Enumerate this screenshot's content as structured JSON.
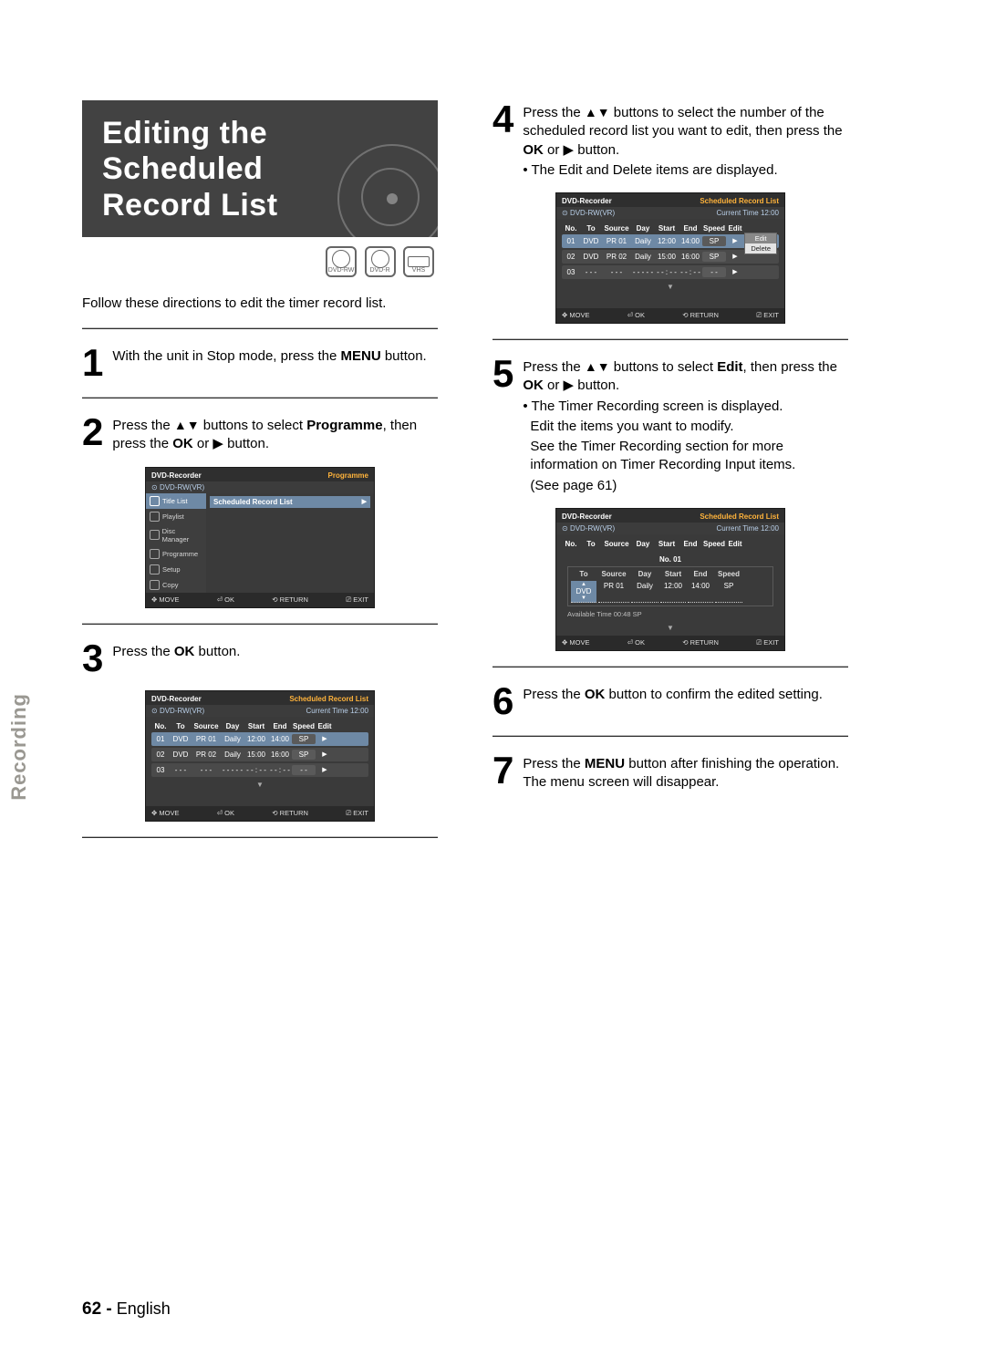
{
  "section_tab": "Recording",
  "title_line1": "Editing the Scheduled",
  "title_line2": "Record List",
  "media": {
    "a": "DVD-RW",
    "b": "DVD-R",
    "c": "VHS"
  },
  "intro": "Follow these directions to edit the timer record list.",
  "steps": {
    "1": {
      "num": "1",
      "a": "With the unit in Stop mode, press the ",
      "b": "MENU",
      "c": " button."
    },
    "2": {
      "num": "2",
      "a": "Press the ",
      "arrows": "▲▼",
      "b": " buttons to select ",
      "c": "Programme",
      "d": ", then press the ",
      "e": "OK",
      "f": " or ",
      "g": "▶",
      "h": " button."
    },
    "3": {
      "num": "3",
      "a": "Press the ",
      "b": "OK",
      "c": " button."
    },
    "4": {
      "num": "4",
      "a": "Press the ",
      "arrows": "▲▼",
      "b": " buttons to select the number of the scheduled record list you want to edit, then press the ",
      "c": "OK",
      "d": " or ",
      "e": "▶",
      "f": " button.",
      "bul": "• The Edit and Delete items are displayed."
    },
    "5": {
      "num": "5",
      "a": "Press the ",
      "arrows": "▲▼",
      "b": " buttons to select ",
      "c": "Edit",
      "d": ", then press the ",
      "e": "OK",
      "f": " or ",
      "g": "▶",
      "h": " button.",
      "l1": "• The Timer Recording screen is displayed.",
      "l2": "Edit the items you want to modify.",
      "l3": "See the Timer Recording section for more information on Timer Recording Input items.",
      "l4": "(See page 61)"
    },
    "6": {
      "num": "6",
      "a": "Press the ",
      "b": "OK",
      "c": " button to confirm the edited setting."
    },
    "7": {
      "num": "7",
      "a": "Press the ",
      "b": "MENU",
      "c": " button after finishing the operation. The menu screen will disappear."
    }
  },
  "osd_common": {
    "device": "DVD-Recorder",
    "disc": "DVD-RW(VR)",
    "srl": "Scheduled Record List",
    "ct_label": "Current Time",
    "ct_value": "12:00",
    "footer": {
      "move": "MOVE",
      "ok": "OK",
      "ret": "RETURN",
      "exit": "EXIT"
    },
    "icons": {
      "move": "✥",
      "ok": "⏎",
      "ret": "⟲",
      "exit": "⎚"
    }
  },
  "osd_prog": {
    "sub": "Programme",
    "menu": [
      "Title List",
      "Playlist",
      "Disc Manager",
      "Programme",
      "Setup",
      "Copy"
    ],
    "rowlabel": "Scheduled Record List",
    "play": "▶"
  },
  "osd_list": {
    "headers": [
      "No.",
      "To",
      "Source",
      "Day",
      "Start",
      "End",
      "Speed",
      "Edit"
    ],
    "rows": [
      {
        "no": "01",
        "to": "DVD",
        "src": "PR 01",
        "day": "Daily",
        "start": "12:00",
        "end": "14:00",
        "spd": "SP",
        "edit": "▶"
      },
      {
        "no": "02",
        "to": "DVD",
        "src": "PR 02",
        "day": "Daily",
        "start": "15:00",
        "end": "16:00",
        "spd": "SP",
        "edit": "▶"
      },
      {
        "no": "03",
        "to": "- - -",
        "src": "- - -",
        "day": "- - - - -",
        "start": "- - : - -",
        "end": "- - : - -",
        "spd": "- -",
        "edit": "▶"
      }
    ],
    "popup": {
      "edit": "Edit",
      "delete": "Delete"
    }
  },
  "osd_edit": {
    "no_label": "No. 01",
    "headers": [
      "To",
      "Source",
      "Day",
      "Start",
      "End",
      "Speed"
    ],
    "row": {
      "to": "DVD",
      "src": "PR 01",
      "day": "Daily",
      "start": "12:00",
      "end": "14:00",
      "spd": "SP"
    },
    "avail": "Available Time   00:48   SP"
  },
  "page_footer": {
    "num": "62 -",
    "lang": " English"
  }
}
